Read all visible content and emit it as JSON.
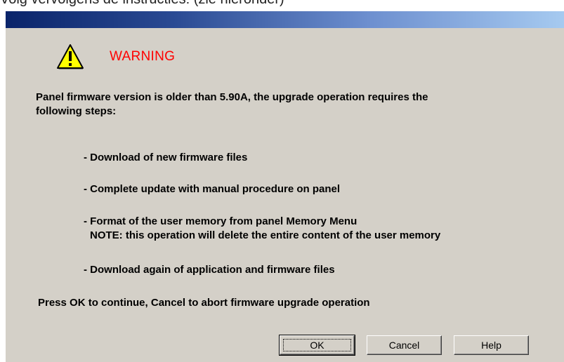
{
  "background_text": "Volg vervolgens de instructies: (zie hieronder)",
  "colors": {
    "dialog_bg": "#d4d0c8",
    "titlebar_start": "#0a246a",
    "titlebar_end": "#a6caf0",
    "warning_text": "#ff0000",
    "warning_icon_fill": "#ffff00"
  },
  "dialog": {
    "warning_icon": "warning-triangle-exclamation-icon",
    "warning_label": "WARNING",
    "intro_line1": "Panel firmware version is older than 5.90A, the upgrade operation requires the",
    "intro_line2": "following steps:",
    "steps": [
      {
        "text": "- Download of new firmware files"
      },
      {
        "text": "- Complete update with manual procedure on panel"
      },
      {
        "text": "- Format of the user memory from panel Memory Menu",
        "note": "NOTE: this operation will delete the entire content of the user memory"
      },
      {
        "text": "- Download again of application and firmware files"
      }
    ],
    "footer": "Press OK to continue, Cancel to abort firmware upgrade operation",
    "buttons": {
      "ok": "OK",
      "cancel": "Cancel",
      "help": "Help"
    }
  }
}
